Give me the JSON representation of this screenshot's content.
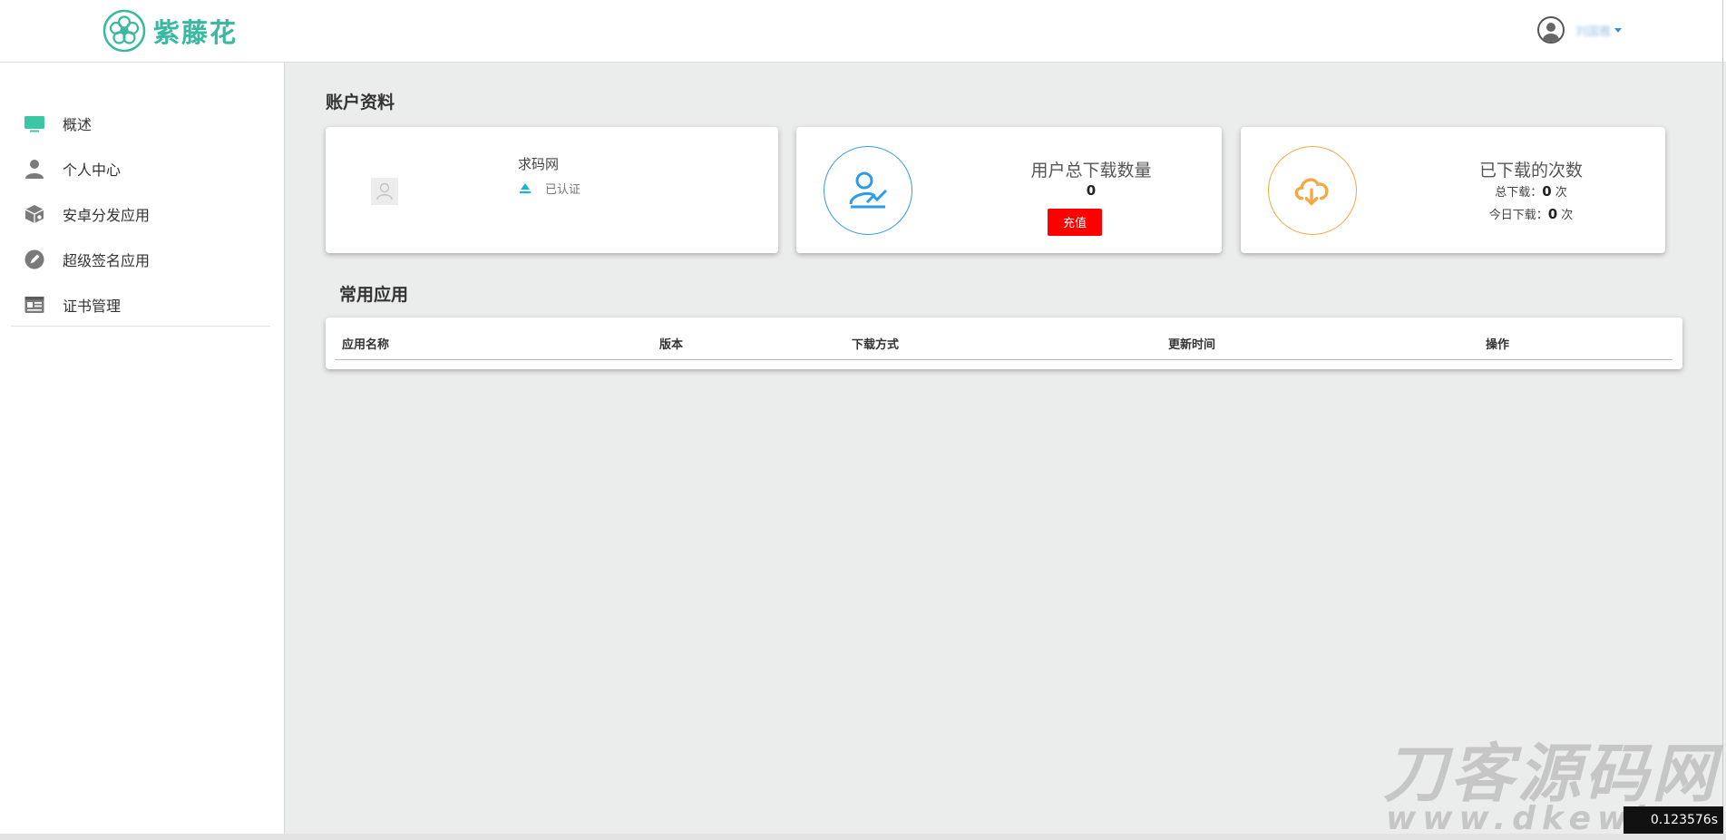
{
  "header": {
    "brand": "紫藤花",
    "username": "刘国雅"
  },
  "sidebar": {
    "items": [
      {
        "label": "概述",
        "icon": "monitor-icon"
      },
      {
        "label": "个人中心",
        "icon": "user-icon"
      },
      {
        "label": "安卓分发应用",
        "icon": "package-icon"
      },
      {
        "label": "超级签名应用",
        "icon": "pen-icon"
      },
      {
        "label": "证书管理",
        "icon": "id-card-icon"
      }
    ]
  },
  "account": {
    "title": "账户资料",
    "profile": {
      "name": "求码网",
      "status": "已认证"
    },
    "downloads_total": {
      "title": "用户总下载数量",
      "value": "0",
      "button": "充值"
    },
    "downloads_used": {
      "title": "已下载的次数",
      "total_label": "总下载：",
      "total_value": "0",
      "today_label": "今日下载：",
      "today_value": "0",
      "unit": "次"
    }
  },
  "apps": {
    "title": "常用应用",
    "columns": [
      "应用名称",
      "版本",
      "下载方式",
      "更新时间",
      "操作"
    ]
  },
  "overlay": {
    "watermark": "刀客源码网",
    "watermark_url": "www.dkewl.com",
    "corner_text": "0.123576s"
  },
  "colors": {
    "brand": "#3bb8a0",
    "accent_blue": "#2e9be8",
    "accent_orange": "#f5a742",
    "button_red": "#ff0000"
  }
}
